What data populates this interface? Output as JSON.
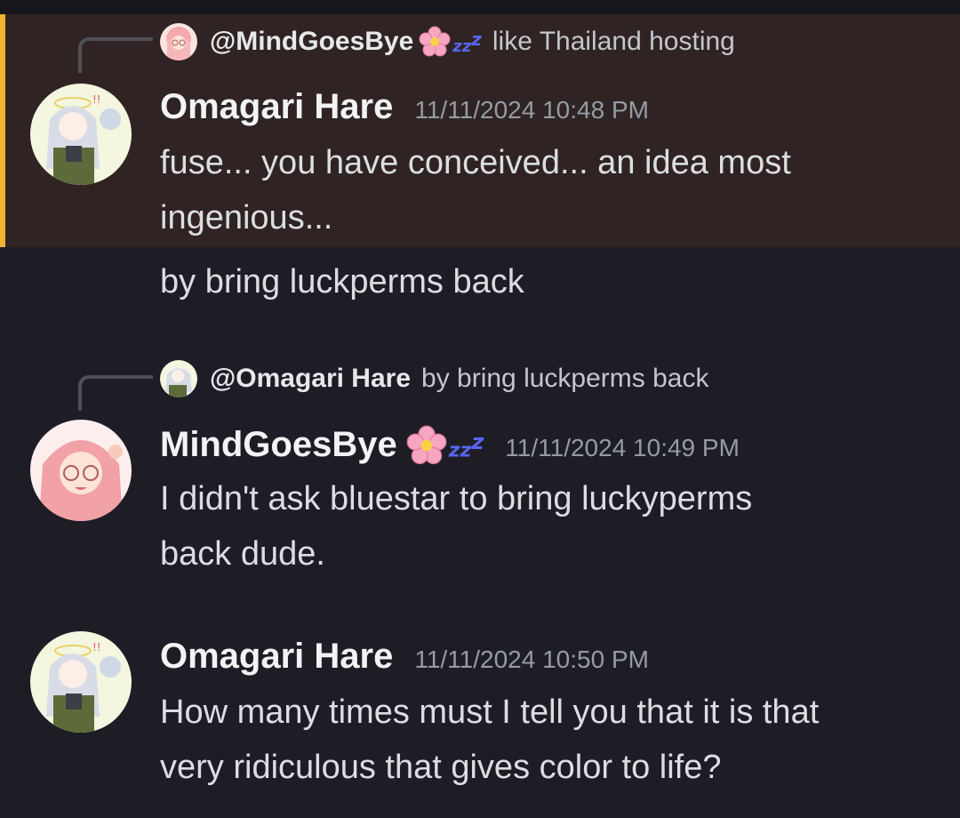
{
  "messages": [
    {
      "reply": {
        "name": "@MindGoesBye",
        "emoji": "cherry-blossom-icon",
        "sleep": "zz",
        "sleep_big": "z",
        "text": "like Thailand hosting"
      },
      "author": "Omagari Hare",
      "timestamp": "11/11/2024 10:48 PM",
      "lines": [
        "fuse... you have conceived... an idea most",
        "ingenious..."
      ],
      "highlighted": true,
      "colors": {
        "highlight_bg": "#2f2423",
        "mention_bar": "#f0b232"
      }
    },
    {
      "continuation": "by bring luckperms back"
    },
    {
      "reply": {
        "name": "@Omagari Hare",
        "text": "by bring luckperms back"
      },
      "author": "MindGoesBye",
      "author_emoji": "cherry-blossom-icon",
      "author_sleep": "zz",
      "author_sleep_big": "z",
      "timestamp": "11/11/2024 10:49 PM",
      "lines": [
        "I didn't ask bluestar to bring luckyperms",
        "back dude."
      ]
    },
    {
      "author": "Omagari Hare",
      "timestamp": "11/11/2024 10:50 PM",
      "lines": [
        "How many times must I tell you that it is that",
        "very ridiculous that gives color to life?"
      ]
    }
  ],
  "colors": {
    "background": "#1e1d26",
    "username": "#f2f3f5",
    "timestamp": "#949ba4",
    "text": "#dbdee1",
    "accent": "#5865f2"
  }
}
